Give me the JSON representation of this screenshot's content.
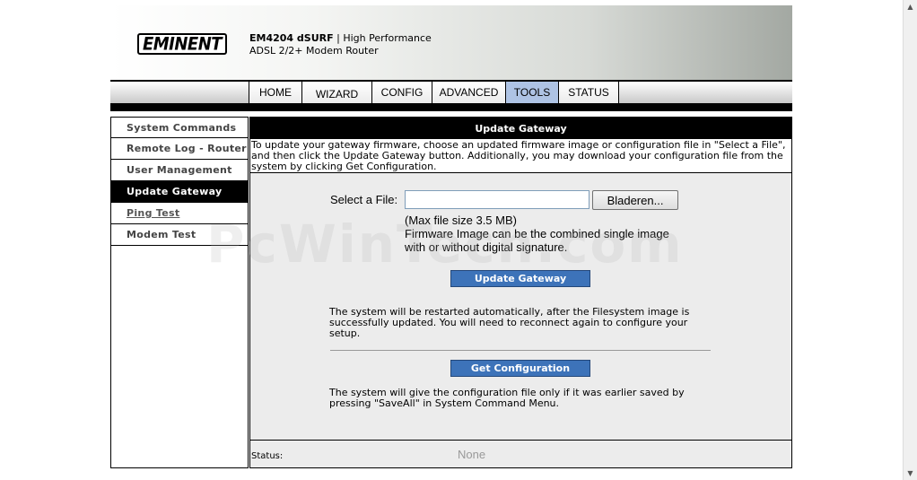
{
  "header": {
    "logo_text": "EMINENT",
    "product_model": "EM4204 dSURF",
    "product_desc1": "| High Performance",
    "product_desc2": "ADSL 2/2+ Modem Router"
  },
  "nav": {
    "tabs": [
      {
        "label": "HOME"
      },
      {
        "label": "WIZARD"
      },
      {
        "label": "CONFIG"
      },
      {
        "label": "ADVANCED"
      },
      {
        "label": "TOOLS",
        "active": true
      },
      {
        "label": "STATUS"
      }
    ]
  },
  "sidebar": {
    "items": [
      {
        "label": "System Commands"
      },
      {
        "label": "Remote Log - Router"
      },
      {
        "label": "User Management"
      },
      {
        "label": "Update Gateway",
        "active": true
      },
      {
        "label": "Ping Test"
      },
      {
        "label": "Modem Test"
      }
    ]
  },
  "main": {
    "title": "Update Gateway",
    "description": "To update your gateway firmware, choose an updated firmware image or configuration file in \"Select a File\", and then click the Update Gateway button. Additionally, you may download your configuration file from the system by clicking Get Configuration.",
    "file_label": "Select a File:",
    "file_value": "",
    "browse_label": "Bladeren...",
    "max_size": "(Max file size 3.5 MB)",
    "firmware_note": "Firmware Image can be the combined single image with or without digital signature.",
    "update_button": "Update Gateway",
    "restart_note": "The system will be restarted automatically, after the Filesystem image is successfully updated. You will need to reconnect again to configure your setup.",
    "config_button": "Get Configuration",
    "config_note": "The system will give the configuration file only if it was earlier saved by pressing \"SaveAll\" in System Command Menu.",
    "status_label": "Status:",
    "status_value": "None"
  },
  "watermark": "PcWinTech.com",
  "icons": {
    "scroll_up": "chevron-up-icon",
    "scroll_down": "chevron-down-icon"
  },
  "colors": {
    "active_tab": "#aec3e4",
    "button_blue": "#3d73b9",
    "panel_bg": "#ececec"
  }
}
